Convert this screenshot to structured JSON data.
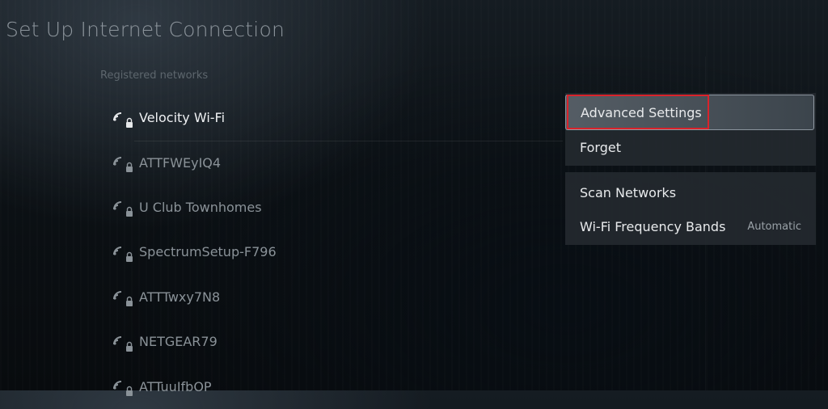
{
  "page": {
    "title": "Set Up Internet Connection"
  },
  "networks": {
    "section_label": "Registered networks",
    "items": [
      {
        "name": "Velocity Wi-Fi",
        "selected": true,
        "locked": true
      },
      {
        "name": "ATTFWEyIQ4",
        "selected": false,
        "locked": true
      },
      {
        "name": "U Club Townhomes",
        "selected": false,
        "locked": true
      },
      {
        "name": "SpectrumSetup-F796",
        "selected": false,
        "locked": true
      },
      {
        "name": "ATTTwxy7N8",
        "selected": false,
        "locked": true
      },
      {
        "name": "NETGEAR79",
        "selected": false,
        "locked": true
      },
      {
        "name": "ATTuuIfbOP",
        "selected": false,
        "locked": true
      }
    ]
  },
  "network_menu": {
    "items": [
      {
        "label": "Advanced Settings",
        "focused": true
      },
      {
        "label": "Forget",
        "focused": false
      }
    ]
  },
  "options_menu": {
    "items": [
      {
        "label": "Scan Networks",
        "value": ""
      },
      {
        "label": "Wi-Fi Frequency Bands",
        "value": "Automatic"
      }
    ]
  },
  "colors": {
    "highlight": "#d9232b",
    "panel": "#242a30"
  },
  "icons": {
    "wifi": "wifi-signal-icon",
    "lock": "lock-icon"
  }
}
